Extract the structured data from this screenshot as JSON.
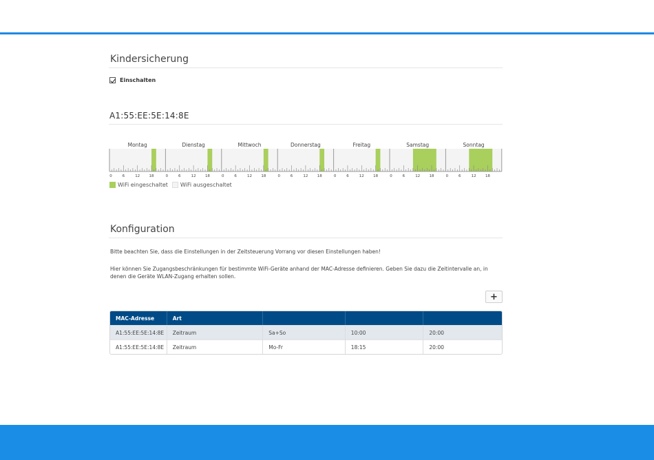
{
  "parental_control": {
    "title": "Kindersicherung",
    "enable_label": "Einschalten",
    "enabled": true
  },
  "device": {
    "mac_title": "A1:55:EE:5E:14:8E"
  },
  "schedule": {
    "days": [
      {
        "label": "Montag",
        "on_ranges": [
          [
            18,
            20
          ]
        ]
      },
      {
        "label": "Dienstag",
        "on_ranges": [
          [
            18,
            20
          ]
        ]
      },
      {
        "label": "Mittwoch",
        "on_ranges": [
          [
            18,
            20
          ]
        ]
      },
      {
        "label": "Donnerstag",
        "on_ranges": [
          [
            18,
            20
          ]
        ]
      },
      {
        "label": "Freitag",
        "on_ranges": [
          [
            18,
            20
          ]
        ]
      },
      {
        "label": "Samstag",
        "on_ranges": [
          [
            10,
            20
          ]
        ]
      },
      {
        "label": "Sonntag",
        "on_ranges": [
          [
            10,
            20
          ]
        ]
      }
    ],
    "tick_labels": [
      "0",
      "6",
      "12",
      "18"
    ],
    "colors": {
      "on": "#a9cf5d",
      "off": "#f4f4f4",
      "frame": "#9a9a9a"
    }
  },
  "legend": {
    "on_label": "WiFi eingeschaltet",
    "off_label": "WiFi ausgeschaltet"
  },
  "config": {
    "title": "Konfiguration",
    "note1": "Bitte beachten Sie, dass die Einstellungen in der Zeitsteuerung Vorrang vor diesen Einstellungen haben!",
    "note2": "Hier können Sie Zugangsbeschränkungen für bestimmte WiFi-Geräte anhand der MAC-Adresse definieren. Geben Sie dazu die Zeitintervalle an, in denen die Geräte WLAN-Zugang erhalten sollen.",
    "add_button": "+"
  },
  "table": {
    "headers": [
      "MAC-Adresse",
      "Art",
      "",
      "",
      ""
    ],
    "rows": [
      [
        "A1:55:EE:5E:14:8E",
        "Zeitraum",
        "Sa+So",
        "10:00",
        "20:00"
      ],
      [
        "A1:55:EE:5E:14:8E",
        "Zeitraum",
        "Mo-Fr",
        "18:15",
        "20:00"
      ]
    ]
  }
}
